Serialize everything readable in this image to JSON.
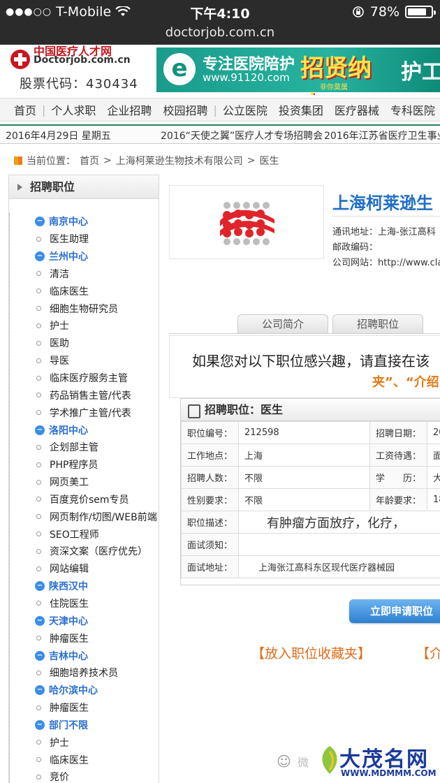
{
  "status_bar": {
    "carrier": "T-Mobile",
    "time": "下午4:10",
    "battery": "78%"
  },
  "browser": {
    "url": "doctorjob.com.cn"
  },
  "header": {
    "logo_cn": "中国医疗人才网",
    "logo_en": "Doctorjob.com.cn",
    "stock_code": "股票代码：430434",
    "ad_title": "专注医院陪护",
    "ad_url": "www.91120.com",
    "ad_hire": "招贤纳士",
    "ad_hire_sub": "非你莫属",
    "ad_tail": "护工"
  },
  "nav": {
    "items": [
      "首页",
      "个人求职",
      "企业招聘",
      "校园招聘",
      "公立医院",
      "投资集团",
      "医疗器械",
      "专科医院"
    ]
  },
  "news_bar": {
    "date": "2016年4月29日 星期五",
    "items": [
      "2016“天使之翼”医疗人才专场招聘会",
      "2016年江苏省医疗卫生事业"
    ]
  },
  "breadcrumb": {
    "label": "当前位置：",
    "home": "首页",
    "company": "上海柯莱逊生物技术有限公司",
    "current": "医生",
    "separator": ">"
  },
  "sidebar": {
    "title": "招聘职位",
    "tree": [
      {
        "type": "group",
        "label": "南京中心"
      },
      {
        "type": "leaf",
        "label": "医生助理"
      },
      {
        "type": "group",
        "label": "兰州中心"
      },
      {
        "type": "leaf",
        "label": "清洁"
      },
      {
        "type": "leaf",
        "label": "临床医生"
      },
      {
        "type": "leaf",
        "label": "细胞生物研究员"
      },
      {
        "type": "leaf",
        "label": "护士"
      },
      {
        "type": "leaf",
        "label": "医助"
      },
      {
        "type": "leaf",
        "label": "导医"
      },
      {
        "type": "leaf",
        "label": "临床医疗服务主管"
      },
      {
        "type": "leaf",
        "label": "药品销售主管/代表"
      },
      {
        "type": "leaf",
        "label": "学术推广主管/代表"
      },
      {
        "type": "group",
        "label": "洛阳中心"
      },
      {
        "type": "leaf",
        "label": "企划部主管"
      },
      {
        "type": "leaf",
        "label": "PHP程序员"
      },
      {
        "type": "leaf",
        "label": "网页美工"
      },
      {
        "type": "leaf",
        "label": "百度竞价sem专员"
      },
      {
        "type": "leaf",
        "label": "网页制作/切图/WEB前端"
      },
      {
        "type": "leaf",
        "label": "SEO工程师"
      },
      {
        "type": "leaf",
        "label": "资深文案（医疗优先）"
      },
      {
        "type": "leaf",
        "label": "网站编辑"
      },
      {
        "type": "group",
        "label": "陕西汉中"
      },
      {
        "type": "leaf",
        "label": "住院医生"
      },
      {
        "type": "group",
        "label": "天津中心"
      },
      {
        "type": "leaf",
        "label": "肿瘤医生"
      },
      {
        "type": "group",
        "label": "吉林中心"
      },
      {
        "type": "leaf",
        "label": "细胞培养技术员"
      },
      {
        "type": "group",
        "label": "哈尔滨中心"
      },
      {
        "type": "leaf",
        "label": "肿瘤医生"
      },
      {
        "type": "group",
        "label": "部门不限"
      },
      {
        "type": "leaf",
        "label": "护士"
      },
      {
        "type": "leaf",
        "label": "临床医生"
      },
      {
        "type": "leaf",
        "label": "竞价"
      }
    ]
  },
  "company": {
    "name": "上海柯莱逊生",
    "address": "通讯地址：上海-张江高科",
    "postcode": "邮政编码：",
    "website": "公司网站：http://www.cla",
    "logo_color": "#e0242b"
  },
  "tabs": [
    "公司简介",
    "招聘职位"
  ],
  "intro": {
    "line1": "如果您对以下职位感兴趣，请直接在该",
    "line2": "夹”、“介绍"
  },
  "job": {
    "title": "招聘职位：医生",
    "rows": [
      {
        "k1": "职位编号：",
        "v1": "212598",
        "k2": "招聘日期：",
        "v2": "20"
      },
      {
        "k1": "工作地点：",
        "v1": "上海",
        "k2": "工资待遇：",
        "v2": "面"
      },
      {
        "k1": "招聘人数：",
        "v1": "不限",
        "k2": "学　　历：",
        "v2": "大"
      },
      {
        "k1": "性别要求：",
        "v1": "不限",
        "k2": "年龄要求：",
        "v2": "18"
      }
    ],
    "description_label": "职位描述：",
    "description": "有肿瘤方面放疗，化疗，",
    "interview_label": "面试须知：",
    "interview": "",
    "address_label": "面试地址：",
    "address": "上海张江高科东区现代医疗器械园"
  },
  "actions": {
    "apply": "立即申请职位",
    "favorite": "【放入职位收藏夹】",
    "introduce": "【介"
  },
  "watermark": {
    "wechat": "微",
    "brand": "大茂名网",
    "url": "WWW.MDMMM.COM"
  }
}
